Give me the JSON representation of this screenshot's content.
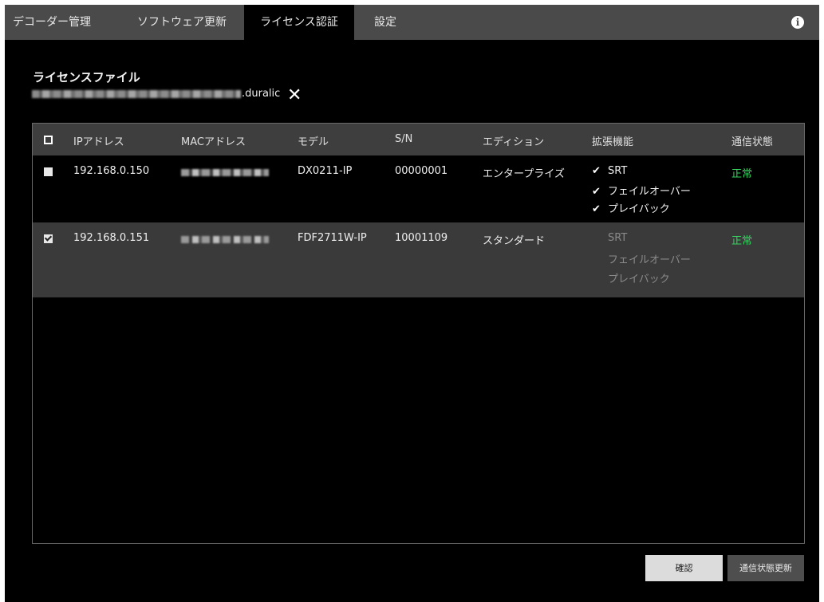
{
  "tabs": [
    {
      "label": "デコーダー管理",
      "active": false
    },
    {
      "label": "ソフトウェア更新",
      "active": false
    },
    {
      "label": "ライセンス認証",
      "active": true
    },
    {
      "label": "設定",
      "active": false
    }
  ],
  "info_icon": "info-icon",
  "license": {
    "title": "ライセンスファイル",
    "file_suffix": ".duralic",
    "clear_icon": "close-icon"
  },
  "table": {
    "headers": [
      "IPアドレス",
      "MACアドレス",
      "モデル",
      "S/N",
      "エディション",
      "拡張機能",
      "通信状態"
    ],
    "rows": [
      {
        "checked": false,
        "ip": "192.168.0.150",
        "model": "DX0211-IP",
        "sn": "00000001",
        "edition": "エンタープライズ",
        "features": [
          {
            "label": "SRT",
            "enabled": true
          },
          {
            "label": "フェイルオーバー",
            "enabled": true
          },
          {
            "label": "プレイバック",
            "enabled": true
          }
        ],
        "status": "正常"
      },
      {
        "checked": true,
        "ip": "192.168.0.151",
        "model": "FDF2711W-IP",
        "sn": "10001109",
        "edition": "スタンダード",
        "features": [
          {
            "label": "SRT",
            "enabled": false
          },
          {
            "label": "フェイルオーバー",
            "enabled": false
          },
          {
            "label": "プレイバック",
            "enabled": false
          }
        ],
        "status": "正常"
      }
    ],
    "check_mark": "✔"
  },
  "buttons": {
    "confirm": "確認",
    "refresh_status": "通信状態更新"
  },
  "colors": {
    "status_ok": "#35d35f",
    "tabbar": "#4a4a4a",
    "selected_row": "#3a3a3a"
  }
}
